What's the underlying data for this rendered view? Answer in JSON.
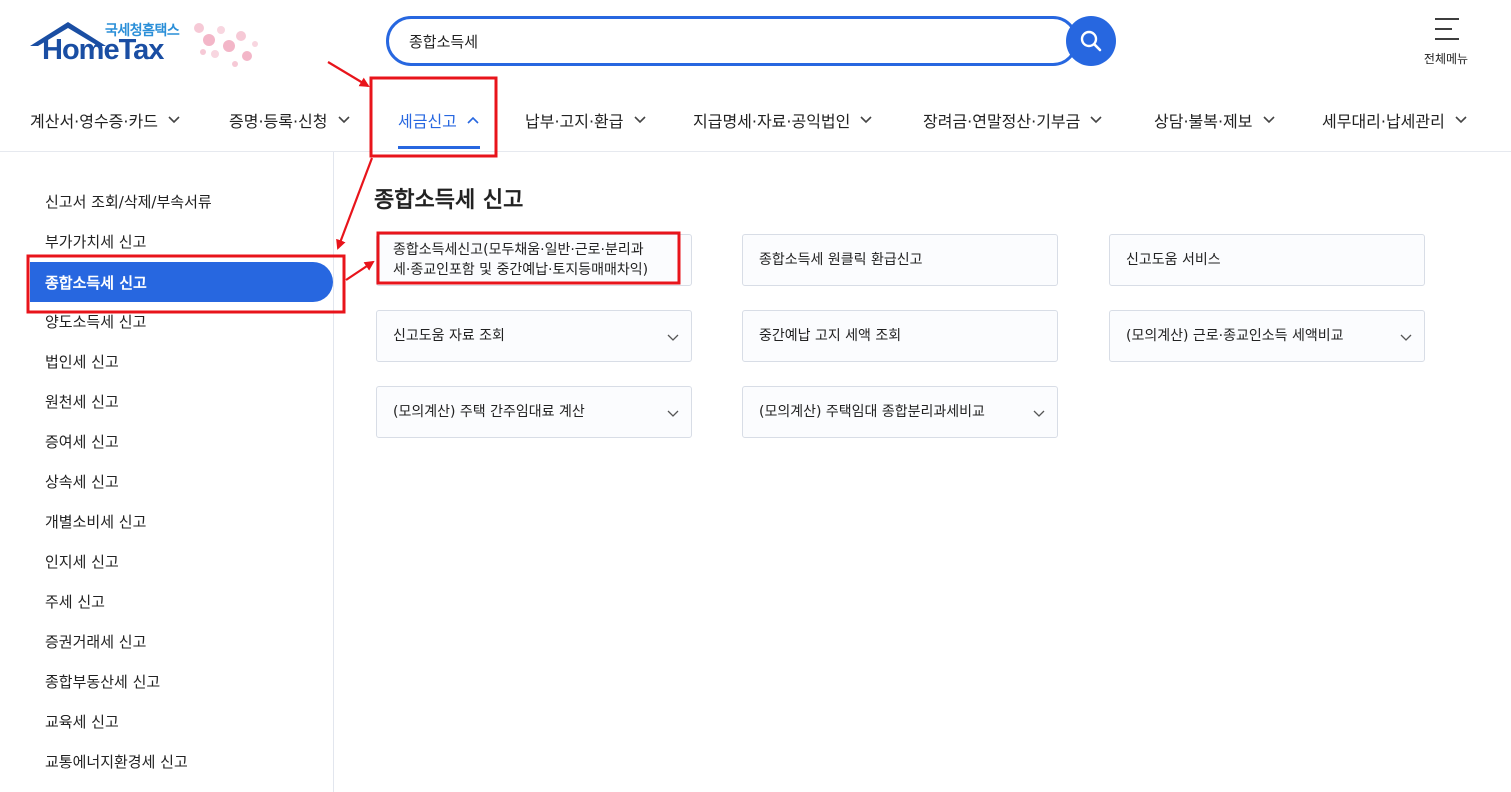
{
  "logo": {
    "sub_text": "국세청홈택스",
    "main_text": "HomeTax"
  },
  "search": {
    "value": "종합소득세"
  },
  "all_menu": {
    "label": "전체메뉴"
  },
  "gnb": {
    "items": [
      {
        "label": "계산서·영수증·카드",
        "active": false
      },
      {
        "label": "증명·등록·신청",
        "active": false
      },
      {
        "label": "세금신고",
        "active": true
      },
      {
        "label": "납부·고지·환급",
        "active": false
      },
      {
        "label": "지급명세·자료·공익법인",
        "active": false
      },
      {
        "label": "장려금·연말정산·기부금",
        "active": false
      },
      {
        "label": "상담·불복·제보",
        "active": false
      },
      {
        "label": "세무대리·납세관리",
        "active": false
      }
    ]
  },
  "sidebar": {
    "items": [
      {
        "label": "신고서 조회/삭제/부속서류"
      },
      {
        "label": "부가가치세 신고"
      },
      {
        "label": "종합소득세 신고",
        "active": true
      },
      {
        "label": "양도소득세 신고"
      },
      {
        "label": "법인세 신고"
      },
      {
        "label": "원천세 신고"
      },
      {
        "label": "증여세 신고"
      },
      {
        "label": "상속세 신고"
      },
      {
        "label": "개별소비세 신고"
      },
      {
        "label": "인지세 신고"
      },
      {
        "label": "주세 신고"
      },
      {
        "label": "증권거래세 신고"
      },
      {
        "label": "종합부동산세 신고"
      },
      {
        "label": "교육세 신고"
      },
      {
        "label": "교통에너지환경세 신고"
      }
    ]
  },
  "main": {
    "title": "종합소득세 신고",
    "cards": [
      {
        "label_line1": "종합소득세신고(모두채움·일반·근로·분리과",
        "label_line2": "세·종교인포함 및 중간예납·토지등매매차익)",
        "has_chevron": false
      },
      {
        "label": "종합소득세 원클릭 환급신고",
        "has_chevron": false
      },
      {
        "label": "신고도움 서비스",
        "has_chevron": false
      },
      {
        "label": "신고도움 자료 조회",
        "has_chevron": true
      },
      {
        "label": "중간예납 고지 세액 조회",
        "has_chevron": false
      },
      {
        "label": "(모의계산) 근로·종교인소득 세액비교",
        "has_chevron": true
      },
      {
        "label": "(모의계산) 주택 간주임대료 계산",
        "has_chevron": true
      },
      {
        "label": "(모의계산) 주택임대 종합분리과세비교",
        "has_chevron": true
      }
    ]
  },
  "colors": {
    "accent": "#2767e0",
    "annotation": "#e8141b"
  }
}
